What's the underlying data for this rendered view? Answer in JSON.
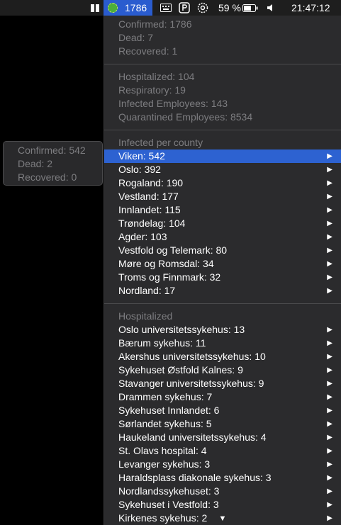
{
  "menubar": {
    "app_count": "1786",
    "battery_percent": "59 %",
    "clock": "21:47:12"
  },
  "menu": {
    "summary": [
      "Confirmed: 1786",
      "Dead: 7",
      "Recovered: 1"
    ],
    "hospital_stats": [
      "Hospitalized: 104",
      "Respiratory: 19",
      "Infected Employees: 143",
      "Quarantined Employees: 8534"
    ],
    "county_header": "Infected per county",
    "counties": [
      "Viken: 542",
      "Oslo: 392",
      "Rogaland: 190",
      "Vestland: 177",
      "Innlandet: 115",
      "Trøndelag: 104",
      "Agder: 103",
      "Vestfold og Telemark: 80",
      "Møre og Romsdal: 34",
      "Troms og Finnmark: 32",
      "Nordland: 17"
    ],
    "hospital_header": "Hospitalized",
    "hospitals": [
      "Oslo universitetssykehus: 13",
      "Bærum sykehus: 11",
      "Akershus universitetssykehus: 10",
      "Sykehuset Østfold Kalnes: 9",
      "Stavanger universitetssykehus: 9",
      "Drammen sykehus: 7",
      "Sykehuset Innlandet: 6",
      "Sørlandet sykehus: 5",
      "Haukeland universitetssykehus: 4",
      "St. Olavs hospital: 4",
      "Levanger sykehus: 3",
      "Haraldsplass diakonale sykehus: 3",
      "Nordlandssykehuset: 3",
      "Sykehuset i Vestfold: 3",
      "Kirkenes sykehus: 2"
    ],
    "submenu_arrow": "▶",
    "more_arrow": "▼"
  },
  "tooltip": [
    "Confirmed: 542",
    "Dead: 2",
    "Recovered: 0"
  ]
}
